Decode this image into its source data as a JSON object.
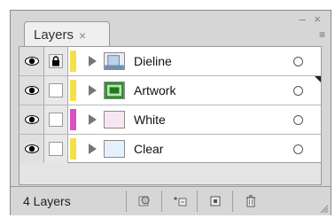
{
  "panel": {
    "tab_title": "Layers",
    "tab_close": "×",
    "window_controls": "– ×",
    "menu_icon": "≡"
  },
  "layers": [
    {
      "name": "Dieline",
      "color": "#f6e04a",
      "visible": true,
      "locked": true,
      "thumb": "dieline-thumbnail",
      "selected": false
    },
    {
      "name": "Artwork",
      "color": "#f6e04a",
      "visible": true,
      "locked": false,
      "thumb": "artwork-thumbnail",
      "selected": true
    },
    {
      "name": "White",
      "color": "#d94fc4",
      "visible": true,
      "locked": false,
      "thumb": "white-thumbnail",
      "selected": false
    },
    {
      "name": "Clear",
      "color": "#f6e04a",
      "visible": true,
      "locked": false,
      "thumb": "clear-thumbnail",
      "selected": false
    }
  ],
  "footer": {
    "count_label": "4 Layers"
  },
  "icons": {
    "eye": "eye-icon",
    "lock": "lock-icon",
    "expand": "expand-triangle-icon",
    "target": "target-circle-icon",
    "make_clipping_mask": "clipping-mask-icon",
    "create_sublayer": "new-sublayer-icon",
    "create_layer": "new-layer-icon",
    "delete": "trash-icon"
  }
}
